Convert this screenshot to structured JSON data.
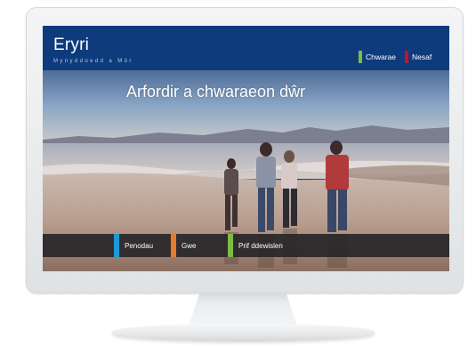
{
  "header": {
    "title": "Eryri",
    "subtitle": "Mynyddoedd a Môr",
    "buttons": [
      {
        "label": "Chwarae",
        "color": "#7dbb47"
      },
      {
        "label": "Nesaf",
        "color": "#c8102e"
      }
    ]
  },
  "hero": {
    "headline": "Arfordir a chwaraeon dŵr"
  },
  "nav": {
    "items": [
      {
        "label": "Penodau",
        "color": "#1e98d6"
      },
      {
        "label": "Gwe",
        "color": "#e77b2d"
      },
      {
        "label": "Prif ddewislen",
        "color": "#7dbb47"
      }
    ]
  },
  "colors": {
    "header_bg": "#0e3b7c",
    "navbar_bg": "#282628"
  }
}
